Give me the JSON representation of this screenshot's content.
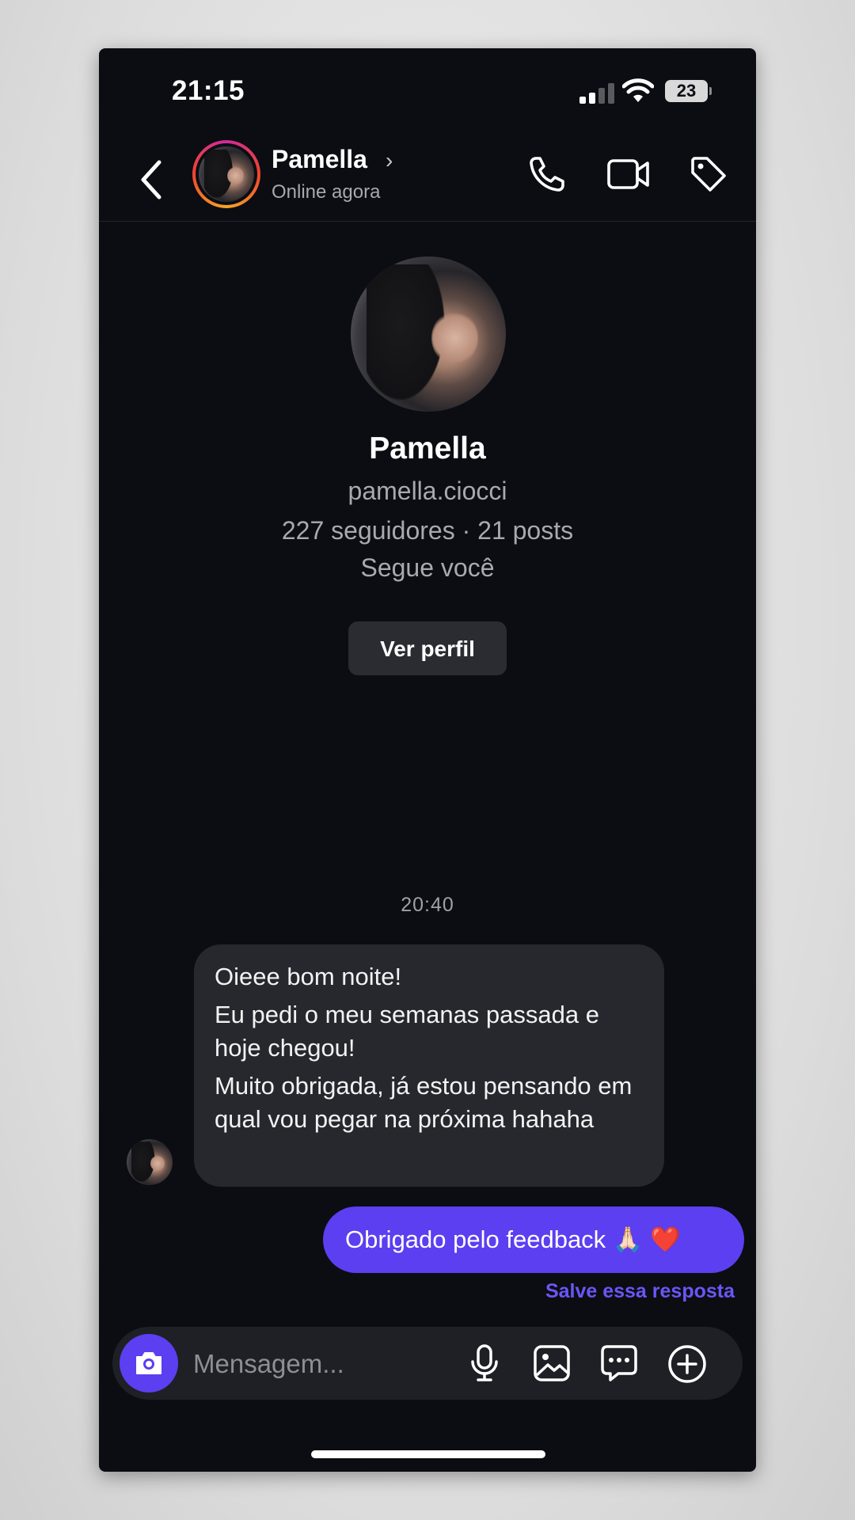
{
  "status_bar": {
    "time": "21:15",
    "battery": "23"
  },
  "header": {
    "contact_name": "Pamella",
    "chevron": "›",
    "presence": "Online agora",
    "icons": [
      "back-chevron-icon",
      "phone-icon",
      "video-icon",
      "tag-icon"
    ]
  },
  "profile": {
    "name": "Pamella",
    "username": "pamella.ciocci",
    "stats": "227 seguidores · 21 posts",
    "follow_status": "Segue você",
    "view_profile_label": "Ver perfil"
  },
  "conversation": {
    "timestamp": "20:40",
    "incoming": {
      "line1": "Oieee bom noite!",
      "line2": "Eu pedi o meu semanas passada e hoje chegou!",
      "line3": "Muito obrigada, já estou pensando em qual vou pegar na próxima hahaha"
    },
    "outgoing": {
      "text": "Obrigado pelo feedback 🙏🏻 ❤️"
    },
    "save_reply_label": "Salve essa resposta"
  },
  "composer": {
    "placeholder": "Mensagem...",
    "icons": [
      "camera-icon",
      "microphone-icon",
      "gallery-icon",
      "sticker-chat-icon",
      "plus-icon"
    ]
  },
  "colors": {
    "accent": "#5b3ff0",
    "background": "#0b0d12",
    "bubble_in": "#26282d"
  }
}
